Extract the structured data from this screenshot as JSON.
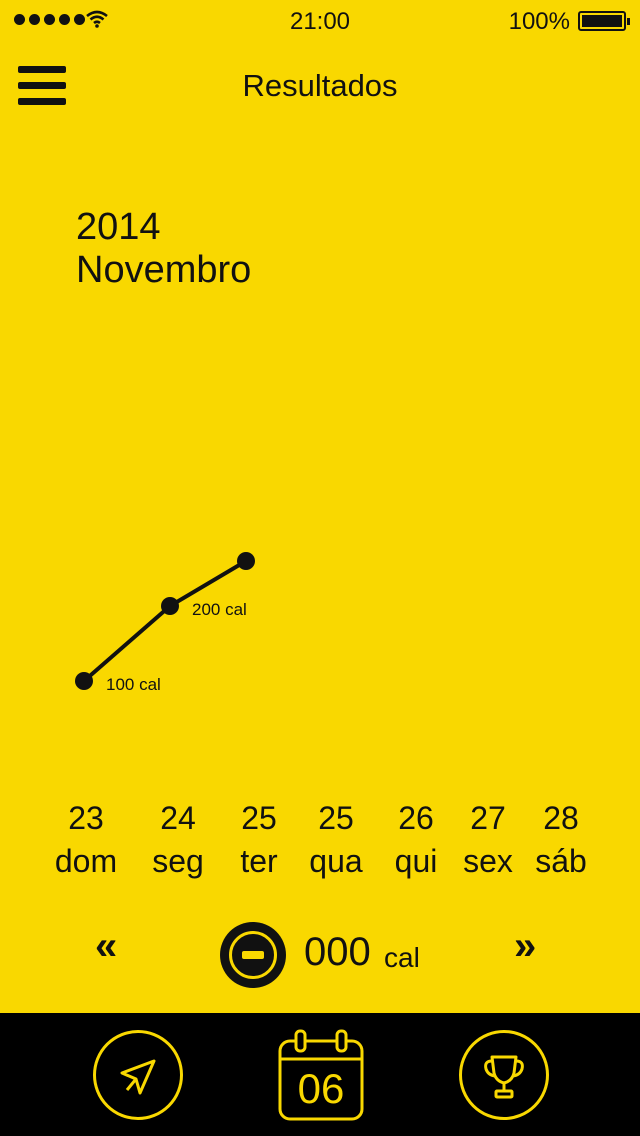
{
  "status_bar": {
    "time": "21:00",
    "battery": "100%",
    "signal_icon": "signal-dots-icon",
    "wifi_icon": "wifi-icon",
    "battery_icon": "battery-icon"
  },
  "header": {
    "title": "Resultados",
    "menu_icon": "hamburger-menu-icon"
  },
  "period": {
    "year": "2014",
    "month": "Novembro"
  },
  "chart_data": {
    "type": "line",
    "series": [
      {
        "values": [
          100,
          200,
          260
        ],
        "point_labels": [
          "100 cal",
          "200 cal",
          ""
        ]
      }
    ],
    "categories": [
      "dom",
      "seg",
      "ter"
    ],
    "ylabel": "",
    "xlabel": "",
    "ylim": [
      0,
      500
    ],
    "grid": false
  },
  "days": [
    {
      "number": "23",
      "name": "dom"
    },
    {
      "number": "24",
      "name": "seg"
    },
    {
      "number": "25",
      "name": "ter"
    },
    {
      "number": "25",
      "name": "qua"
    },
    {
      "number": "26",
      "name": "qui"
    },
    {
      "number": "27",
      "name": "sex"
    },
    {
      "number": "28",
      "name": "sáb"
    }
  ],
  "controls": {
    "prev_label": "«",
    "next_label": "»",
    "calories_value": "000",
    "calories_unit": "cal",
    "minus_icon": "minus-circle-icon"
  },
  "tabbar": {
    "send_icon": "send-arrow-icon",
    "calendar_icon": "calendar-icon",
    "calendar_day": "06",
    "trophy_icon": "trophy-icon"
  },
  "colors": {
    "background": "#f9d800",
    "foreground": "#111111",
    "tabbar": "#000000"
  }
}
